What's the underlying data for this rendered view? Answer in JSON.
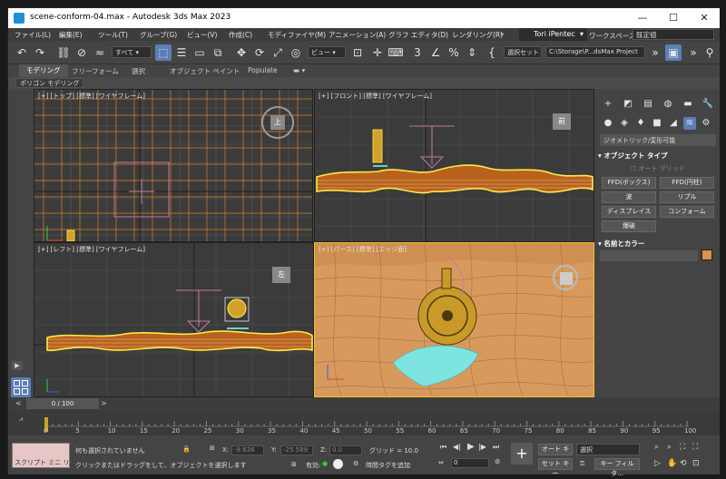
{
  "window": {
    "title": "scene-conform-04.max - Autodesk 3ds Max 2023"
  },
  "menu": [
    "ファイル(L)",
    "編集(E)",
    "ツール(T)",
    "グループ(G)",
    "ビュー(V)",
    "作成(C)",
    "モディファイヤ(M)",
    "アニメーション(A)",
    "グラフ エディタ(D)",
    "レンダリング(R)"
  ],
  "user": {
    "name": "Tori iPentec"
  },
  "workspace": {
    "label": "ワークスペース:",
    "value": "既定値"
  },
  "toolbar": {
    "filter": "すべて",
    "view_ref": "ビュー",
    "selection_set": "選択セット",
    "project_path": "C:\\Storage\\P...dsMax Project"
  },
  "ribbon": {
    "tabs": [
      "モデリング",
      "フリーフォーム",
      "選択",
      "オブジェクト ペイント",
      "Populate"
    ],
    "sub_label": "ポリゴン モデリング"
  },
  "viewports": {
    "top": "[+] [トップ] [標準] [ワイヤフレーム]",
    "front": "[+] [フロント] [標準] [ワイヤフレーム]",
    "left": "[+] [レフト] [標準] [ワイヤフレーム]",
    "persp": "[+] [パース] [標準] [エッジ面]",
    "cube_top": "上",
    "cube_front": "前",
    "cube_left": "左"
  },
  "command_panel": {
    "category": "ジオメトリック/変形可能",
    "object_type_title": "オブジェクト タイプ",
    "autogrid": "オート グリッド",
    "buttons": [
      "FFD(ボックス)",
      "FFD(円柱)",
      "波",
      "リプル",
      "ディスプレイス",
      "コンフォーム",
      "爆破"
    ],
    "name_color_title": "名前とカラー",
    "object_color": "#d9944d"
  },
  "time": {
    "slider": "0 / 100",
    "ticks": [
      "0",
      "5",
      "10",
      "15",
      "20",
      "25",
      "30",
      "35",
      "40",
      "45",
      "50",
      "55",
      "60",
      "65",
      "70",
      "75",
      "80",
      "85",
      "90",
      "95",
      "100"
    ]
  },
  "status": {
    "maxscript": "スクリプト ミニ リス",
    "selection": "何も選択されていません",
    "prompt": "クリックまたはドラッグをして、オブジェクトを選択します",
    "x_label": "X:",
    "x_value": "-9.636",
    "y_label": "Y:",
    "y_value": "-25.589",
    "z_label": "Z:",
    "z_value": "0.0",
    "grid": "グリッド = 10.0",
    "enabled": "有効:",
    "add_time_tag": "時間タグを追加",
    "autokey": "オート キー",
    "setkey": "セット キー",
    "key_mode": "選択",
    "key_filter": "キー フィルタ...",
    "frame": "0"
  }
}
